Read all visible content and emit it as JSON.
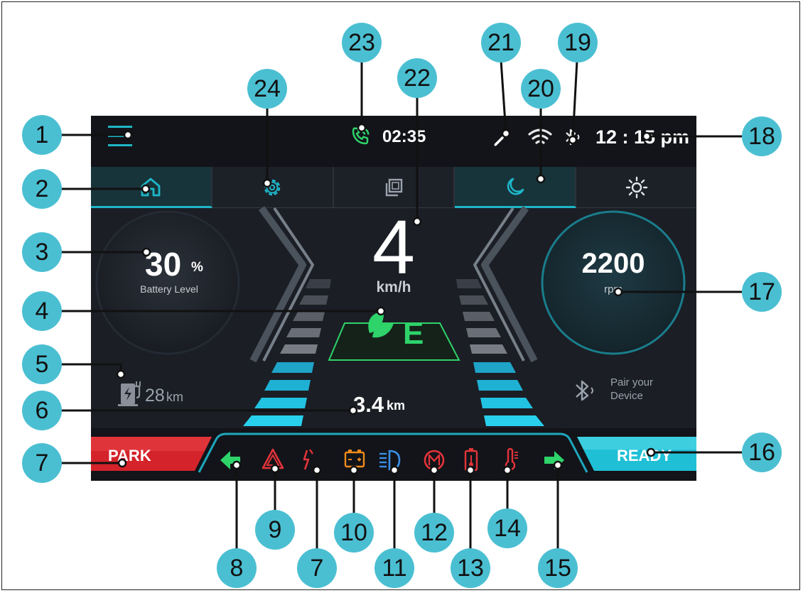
{
  "topbar": {
    "call_timer": "02:35",
    "clock": "12 : 15 pm"
  },
  "speed": {
    "value": "4",
    "unit": "km/h"
  },
  "battery": {
    "value": "30",
    "unit": "%",
    "label": "Battery Level"
  },
  "rpm": {
    "value": "2200",
    "unit": "rpm"
  },
  "eco_mode": {
    "letter": "E"
  },
  "range": {
    "value": "28",
    "unit": "km"
  },
  "trip": {
    "value": "3.4",
    "unit": "km"
  },
  "pair": {
    "line1": "Pair your",
    "line2": "Device"
  },
  "gear": {
    "park_label": "PARK",
    "ready_label": "READY"
  },
  "callouts": [
    "1",
    "2",
    "3",
    "4",
    "5",
    "6",
    "7",
    "8",
    "9",
    "7",
    "10",
    "11",
    "12",
    "13",
    "14",
    "15",
    "16",
    "17",
    "18",
    "19",
    "20",
    "21",
    "22",
    "23",
    "24"
  ],
  "colors": {
    "accent": "#1eb6c8",
    "callout": "#4bbfd2",
    "eco_green": "#2ed36a",
    "park_red": "#e0262b",
    "ready_cyan": "#2fc9dc",
    "warning_orange": "#f08a1c",
    "alert_red": "#e5333a",
    "headlight_blue": "#3a8ee6"
  },
  "icons": {
    "menu": "menu-icon",
    "home": "home-icon",
    "settings": "gear-icon",
    "windows": "windows-icon",
    "night": "moon-icon",
    "day": "sun-icon",
    "call": "phone-call-icon",
    "wrench": "wrench-icon",
    "wifi": "wifi-icon",
    "bluetooth": "bluetooth-icon"
  }
}
